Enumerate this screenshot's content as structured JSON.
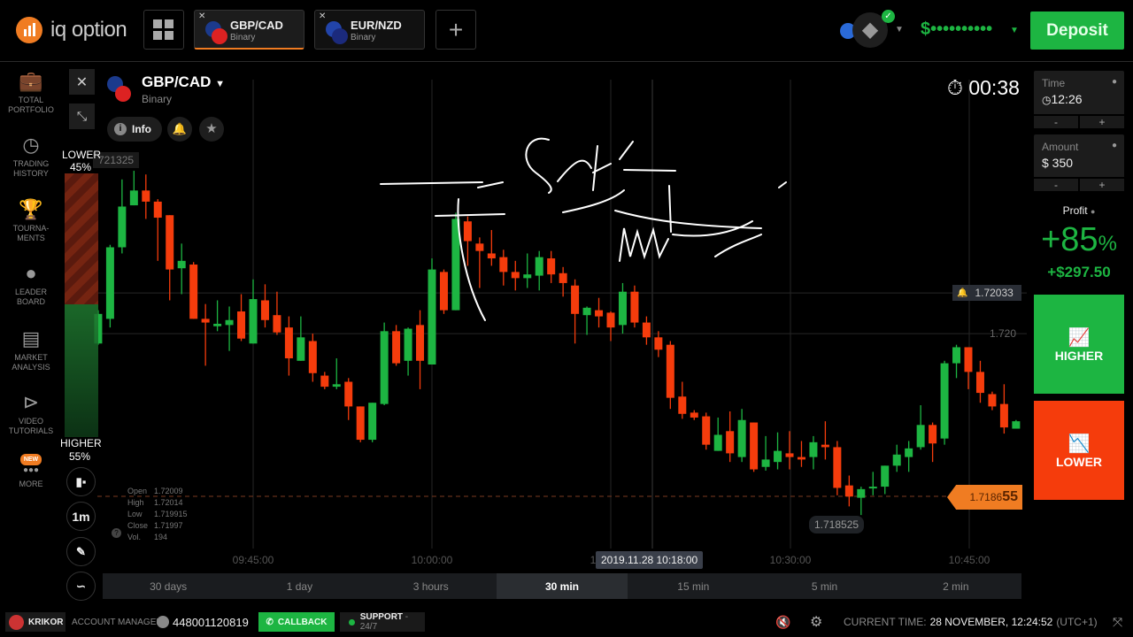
{
  "brand": {
    "name": "iq option",
    "accent": "#f07c22"
  },
  "tabs": [
    {
      "pair": "GBP/CAD",
      "type": "Binary",
      "active": true
    },
    {
      "pair": "EUR/NZD",
      "type": "Binary",
      "active": false
    }
  ],
  "header": {
    "balance": "$••••••••••",
    "deposit": "Deposit"
  },
  "sidebar": [
    {
      "label": "TOTAL PORTFOLIO",
      "icon": "briefcase-icon"
    },
    {
      "label": "TRADING HISTORY",
      "icon": "history-icon"
    },
    {
      "label": "TOURNA-MENTS",
      "icon": "trophy-icon"
    },
    {
      "label": "LEADER BOARD",
      "icon": "medal-icon"
    },
    {
      "label": "MARKET ANALYSIS",
      "icon": "newspaper-icon"
    },
    {
      "label": "VIDEO TUTORIALS",
      "icon": "play-icon"
    },
    {
      "label": "MORE",
      "icon": "more-icon",
      "badge": "NEW"
    }
  ],
  "asset": {
    "pair": "GBP/CAD",
    "type": "Binary",
    "info": "Info"
  },
  "sentiment": {
    "lower_label": "LOWER",
    "lower_pct": "45%",
    "higher_label": "HIGHER",
    "higher_pct": "55%",
    "lower_fraction": 0.45,
    "higher_fraction": 0.55
  },
  "chart_tools": {
    "interval": "1m"
  },
  "ohlc": {
    "labels": [
      "Open",
      "High",
      "Low",
      "Close",
      "Vol."
    ],
    "values": [
      "1.72009",
      "1.72014",
      "1.719915",
      "1.71997",
      "194"
    ]
  },
  "timer": "00:38",
  "trade": {
    "time_label": "Time",
    "time_value": "12:26",
    "amount_label": "Amount",
    "amount_value": "$ 350",
    "minus": "-",
    "plus": "+",
    "profit_label": "Profit",
    "profit_pct": "+85",
    "pct_sign": "%",
    "profit_value": "+$297.50",
    "higher": "HIGHER",
    "lower": "LOWER",
    "higher_color": "#1db542",
    "lower_color": "#f53c0c"
  },
  "price_labels": {
    "alert": "1.72033",
    "grid": "1.720",
    "top_cut": "721325",
    "current": "1.7186",
    "current_big": "55",
    "low": "1.718525",
    "crosshair_time": "2019.11.28 10:18:00"
  },
  "chart_data": {
    "type": "candlestick",
    "interval": "1m",
    "x_start": "09:32",
    "xticks": [
      "09:45:00",
      "10:00:00",
      "10:15:00",
      "10:30:00",
      "10:45:00"
    ],
    "yticks": [
      "1.720"
    ],
    "up_color": "#1db542",
    "down_color": "#f53c0c",
    "ohlc": [
      [
        1.71992,
        1.72019,
        1.71991,
        1.72016
      ],
      [
        1.72012,
        1.72072,
        1.72005,
        1.7207
      ],
      [
        1.7207,
        1.72125,
        1.72065,
        1.72103
      ],
      [
        1.72104,
        1.72132,
        1.72104,
        1.72116
      ],
      [
        1.72116,
        1.72129,
        1.72093,
        1.72107
      ],
      [
        1.72107,
        1.72109,
        1.72059,
        1.72094
      ],
      [
        1.72096,
        1.72096,
        1.72027,
        1.72052
      ],
      [
        1.72053,
        1.72073,
        1.72032,
        1.72059
      ],
      [
        1.72056,
        1.72058,
        1.72012,
        1.72012
      ],
      [
        1.72012,
        1.72024,
        1.71974,
        1.72009
      ],
      [
        1.72006,
        1.72027,
        1.72002,
        1.72008
      ],
      [
        1.72007,
        1.72022,
        1.71986,
        1.72011
      ],
      [
        1.72018,
        1.72032,
        1.71994,
        1.71996
      ],
      [
        1.71992,
        1.72044,
        1.71992,
        1.72028
      ],
      [
        1.72027,
        1.7204,
        1.72005,
        1.72011
      ],
      [
        1.72015,
        1.72034,
        1.71999,
        1.72001
      ],
      [
        1.72005,
        1.72014,
        1.71966,
        1.7198
      ],
      [
        1.71978,
        1.72014,
        1.71978,
        1.71997
      ],
      [
        1.71994,
        1.72,
        1.71961,
        1.71968
      ],
      [
        1.71966,
        1.71969,
        1.71955,
        1.71957
      ],
      [
        1.71957,
        1.7198,
        1.71955,
        1.71959
      ],
      [
        1.71961,
        1.71964,
        1.7193,
        1.71941
      ],
      [
        1.71941,
        1.71941,
        1.71912,
        1.71914
      ],
      [
        1.71914,
        1.71944,
        1.71912,
        1.71944
      ],
      [
        1.71943,
        1.72009,
        1.71942,
        1.72002
      ],
      [
        1.72002,
        1.72007,
        1.71974,
        1.71976
      ],
      [
        1.71978,
        1.72005,
        1.71966,
        1.72004
      ],
      [
        1.72007,
        1.72019,
        1.71955,
        1.71978
      ],
      [
        1.71975,
        1.72061,
        1.71975,
        1.72052
      ],
      [
        1.7205,
        1.72052,
        1.72016,
        1.72019
      ],
      [
        1.72019,
        1.72098,
        1.72019,
        1.72093
      ],
      [
        1.72091,
        1.72095,
        1.72055,
        1.72075
      ],
      [
        1.72073,
        1.72078,
        1.72037,
        1.72067
      ],
      [
        1.72065,
        1.72084,
        1.72055,
        1.72061
      ],
      [
        1.72062,
        1.72068,
        1.72039,
        1.7205
      ],
      [
        1.7205,
        1.72059,
        1.72035,
        1.72045
      ],
      [
        1.72045,
        1.72065,
        1.72037,
        1.72048
      ],
      [
        1.72047,
        1.72067,
        1.72035,
        1.72062
      ],
      [
        1.72061,
        1.72067,
        1.72041,
        1.72048
      ],
      [
        1.72049,
        1.72054,
        1.7203,
        1.72041
      ],
      [
        1.72039,
        1.72044,
        1.71992,
        1.72016
      ],
      [
        1.72015,
        1.72022,
        1.71999,
        1.72021
      ],
      [
        1.72019,
        1.72029,
        1.72005,
        1.72014
      ],
      [
        1.72017,
        1.72018,
        1.71994,
        1.72005
      ],
      [
        1.72007,
        1.72041,
        1.72,
        1.72034
      ],
      [
        1.72034,
        1.72039,
        1.72005,
        1.72009
      ],
      [
        1.72009,
        1.72014,
        1.71991,
        1.71997
      ],
      [
        1.71997,
        1.72002,
        1.71981,
        1.71987
      ],
      [
        1.71991,
        1.71994,
        1.71939,
        1.71948
      ],
      [
        1.71949,
        1.71961,
        1.71931,
        1.71935
      ],
      [
        1.71936,
        1.71938,
        1.7193,
        1.71932
      ],
      [
        1.71933,
        1.71936,
        1.71906,
        1.7191
      ],
      [
        1.71905,
        1.71932,
        1.71905,
        1.71918
      ],
      [
        1.71921,
        1.71937,
        1.71896,
        1.71903
      ],
      [
        1.719,
        1.71939,
        1.71896,
        1.7193
      ],
      [
        1.71928,
        1.71928,
        1.71888,
        1.7189
      ],
      [
        1.71892,
        1.71917,
        1.71889,
        1.71898
      ],
      [
        1.71896,
        1.7192,
        1.7189,
        1.71905
      ],
      [
        1.71903,
        1.71921,
        1.7189,
        1.719
      ],
      [
        1.719,
        1.71913,
        1.71892,
        1.71898
      ],
      [
        1.719,
        1.71917,
        1.7189,
        1.71912
      ],
      [
        1.7191,
        1.71929,
        1.71898,
        1.71908
      ],
      [
        1.71908,
        1.71913,
        1.71869,
        1.71875
      ],
      [
        1.71877,
        1.71885,
        1.7186,
        1.71868
      ],
      [
        1.71867,
        1.71876,
        1.71853,
        1.71874
      ],
      [
        1.71875,
        1.71888,
        1.71869,
        1.71876
      ],
      [
        1.71876,
        1.71893,
        1.7187,
        1.71893
      ],
      [
        1.71893,
        1.7191,
        1.71888,
        1.71902
      ],
      [
        1.719,
        1.71913,
        1.71888,
        1.71907
      ],
      [
        1.71908,
        1.71942,
        1.71906,
        1.71926
      ],
      [
        1.71926,
        1.71928,
        1.71896,
        1.71911
      ],
      [
        1.71915,
        1.71978,
        1.7191,
        1.71976
      ],
      [
        1.71976,
        1.71991,
        1.71964,
        1.71989
      ],
      [
        1.71989,
        1.71989,
        1.71955,
        1.71969
      ],
      [
        1.71969,
        1.71978,
        1.71944,
        1.71952
      ],
      [
        1.71951,
        1.71953,
        1.71938,
        1.71941
      ],
      [
        1.71943,
        1.71959,
        1.71919,
        1.71924
      ],
      [
        1.71923,
        1.7193,
        1.71923,
        1.71929
      ]
    ]
  },
  "periods": [
    {
      "label": "30 days"
    },
    {
      "label": "1 day"
    },
    {
      "label": "3 hours"
    },
    {
      "label": "30 min",
      "selected": true
    },
    {
      "label": "15 min"
    },
    {
      "label": "5 min"
    },
    {
      "label": "2 min"
    }
  ],
  "footer": {
    "manager_name": "KRIKOR",
    "manager_label": "ACCOUNT MANAGER",
    "phone": "448001120819",
    "callback": "CALLBACK",
    "support": "SUPPORT",
    "support_hours": " - 24/7",
    "time_label": "CURRENT TIME:",
    "time_value": "28 NOVEMBER, 12:24:52",
    "tz": "(UTC+1)"
  }
}
